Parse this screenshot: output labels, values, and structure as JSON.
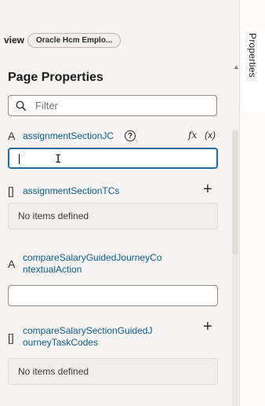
{
  "breadcrumb": {
    "prefix": "view",
    "pill": "Oracle Hcm Emplo..."
  },
  "side_tab": {
    "label": "Properties",
    "icon": "chevron-up-icon"
  },
  "panel": {
    "title": "Page Properties"
  },
  "filter": {
    "placeholder": "Filter",
    "value": "",
    "icon": "search-icon"
  },
  "properties": [
    {
      "icon": "text-type-icon",
      "icon_glyph": "A",
      "label": "assignmentSectionJC",
      "help": "?",
      "fx": "fx",
      "expr": "(x)",
      "value": ""
    },
    {
      "icon": "array-type-icon",
      "icon_glyph": "[]",
      "label": "assignmentSectionTCs",
      "empty_text": "No items defined"
    },
    {
      "icon": "text-type-icon",
      "icon_glyph": "A",
      "label_line1": "compareSalaryGuidedJourneyCo",
      "label_line2": "ntextualAction",
      "value": ""
    },
    {
      "icon": "array-type-icon",
      "icon_glyph": "[]",
      "label_line1": "compareSalarySectionGuidedJ",
      "label_line2": "ourneyTaskCodes",
      "empty_text": "No items defined"
    }
  ],
  "colors": {
    "link": "#0b5d8a",
    "focus": "#1c6f99",
    "panel_bg": "#f5f4f2"
  }
}
